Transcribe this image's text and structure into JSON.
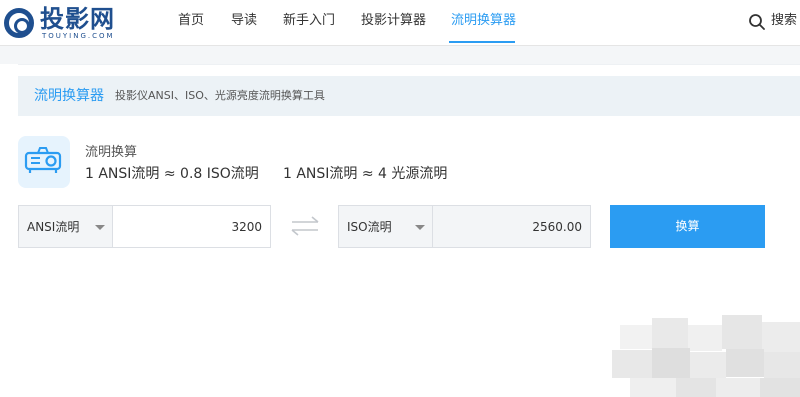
{
  "brand": {
    "name": "投影网",
    "sub": "TOUYING.COM"
  },
  "nav": {
    "items": [
      {
        "label": "首页"
      },
      {
        "label": "导读"
      },
      {
        "label": "新手入门"
      },
      {
        "label": "投影计算器"
      },
      {
        "label": "流明换算器",
        "active": true
      }
    ],
    "search_label": "搜索"
  },
  "tool": {
    "title": "流明换算器",
    "subtitle": "投影仪ANSI、ISO、光源亮度流明换算工具"
  },
  "info": {
    "label": "流明换算",
    "formulas": [
      "1 ANSI流明 ≈ 0.8 ISO流明",
      "1 ANSI流明 ≈ 4 光源流明"
    ]
  },
  "converter": {
    "from_unit": "ANSI流明",
    "from_value": "3200",
    "to_unit": "ISO流明",
    "to_value": "2560.00",
    "button_label": "换算"
  },
  "colors": {
    "accent": "#2b9cf2",
    "brand": "#1f4f8f",
    "title_bar_bg": "#ecf2f6",
    "field_bg": "#f3f5f7"
  },
  "icons": [
    "projector-icon",
    "search-icon",
    "swap-arrows-icon",
    "caret-down-icon"
  ]
}
